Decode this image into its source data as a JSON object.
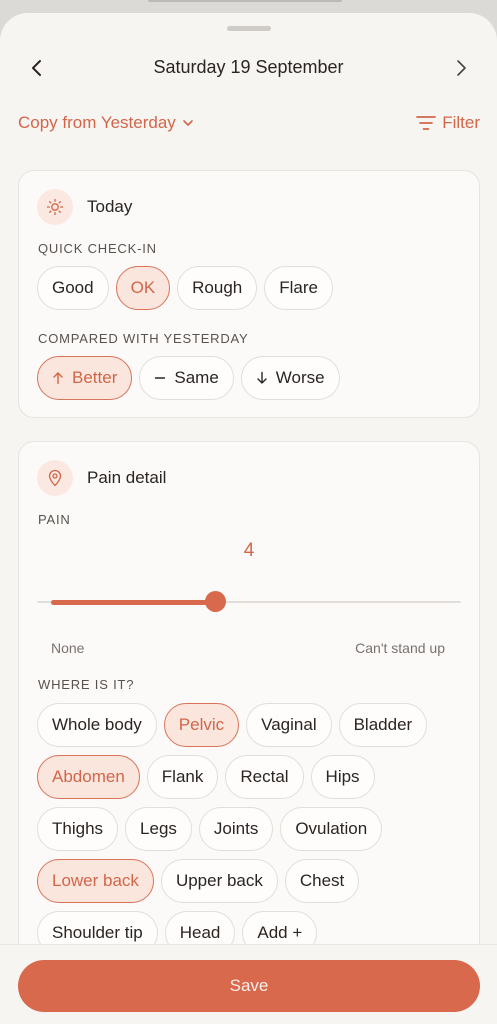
{
  "colors": {
    "accent": "#d8694c",
    "accent_text": "#d1664a",
    "accent_soft": "#fbe6de",
    "background": "#f7f5f2",
    "card": "#fbfaf8"
  },
  "header": {
    "title": "Saturday 19 September",
    "prev_icon": "chevron-left-icon",
    "next_icon": "chevron-right-icon"
  },
  "toolbar": {
    "copy_label": "Copy from Yesterday",
    "copy_icon": "chevron-down-icon",
    "filter_label": "Filter",
    "filter_icon": "filter-icon"
  },
  "today": {
    "title": "Today",
    "icon": "sun-icon",
    "quick_label": "QUICK CHECK-IN",
    "quick_options": [
      "Good",
      "OK",
      "Rough",
      "Flare"
    ],
    "quick_selected": "OK",
    "compare_label": "COMPARED WITH YESTERDAY",
    "compare_options": [
      {
        "label": "Better",
        "icon": "arrow-up-icon",
        "selected": true
      },
      {
        "label": "Same",
        "icon": "minus-icon",
        "selected": false
      },
      {
        "label": "Worse",
        "icon": "arrow-down-icon",
        "selected": false
      }
    ]
  },
  "pain": {
    "title": "Pain detail",
    "icon": "location-pin-icon",
    "pain_label": "PAIN",
    "value": "4",
    "slider_fraction": 0.4,
    "min_label": "None",
    "max_label": "Can't stand up",
    "where_label": "WHERE IS IT?",
    "locations": [
      [
        "Whole body",
        "Pelvic",
        "Vaginal",
        "Bladder"
      ],
      [
        "Abdomen",
        "Flank",
        "Rectal",
        "Hips"
      ],
      [
        "Thighs",
        "Legs",
        "Joints",
        "Ovulation"
      ],
      [
        "Lower back",
        "Upper back",
        "Chest"
      ],
      [
        "Shoulder tip",
        "Head",
        "Add +"
      ]
    ],
    "selected_locations": [
      "Pelvic",
      "Abdomen",
      "Lower back"
    ]
  },
  "footer": {
    "save_label": "Save"
  }
}
